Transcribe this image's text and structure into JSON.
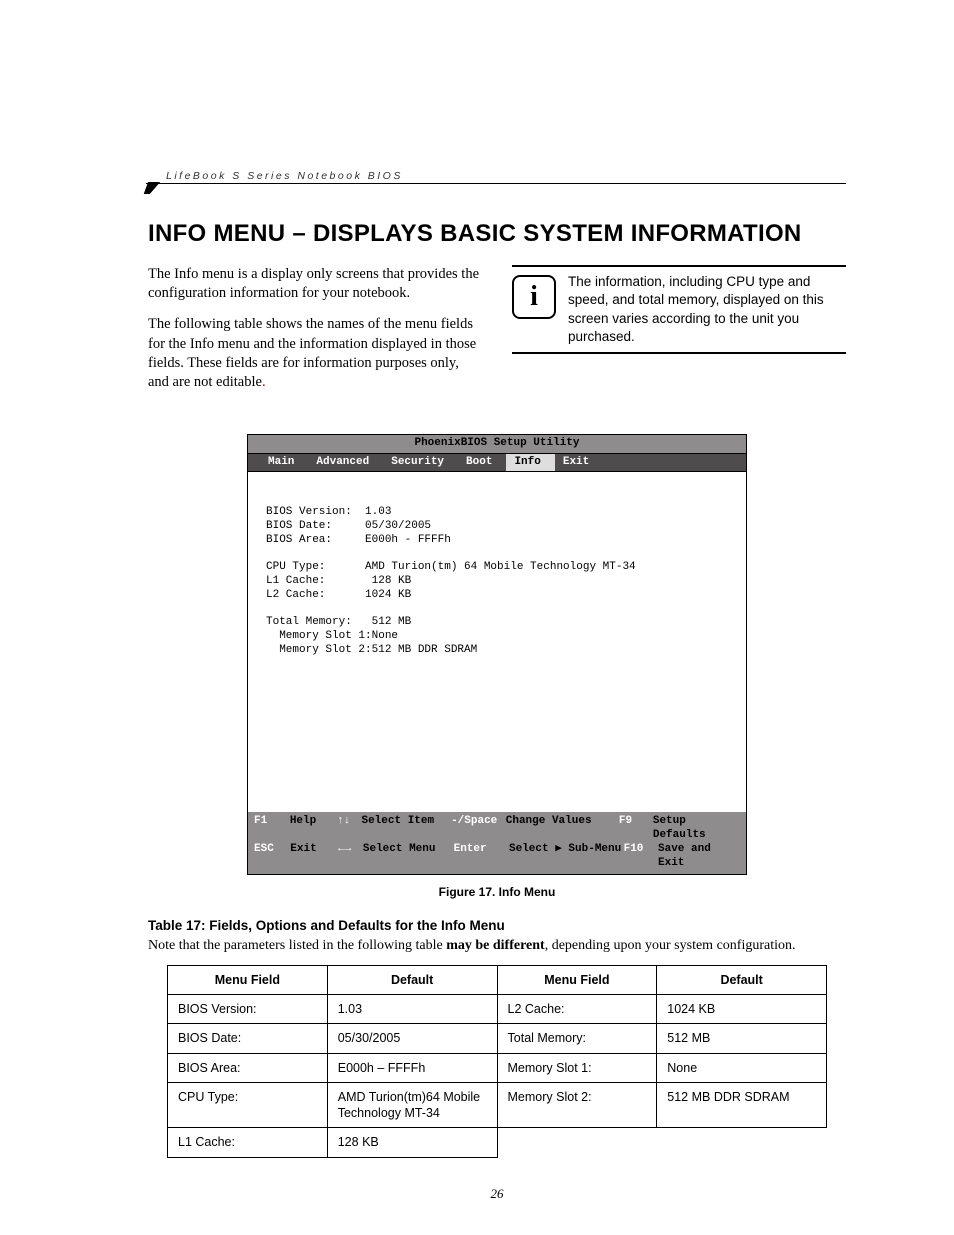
{
  "header": {
    "running": "LifeBook S Series Notebook BIOS"
  },
  "title": "INFO MENU – DISPLAYS BASIC SYSTEM INFORMATION",
  "para1": "The Info menu is a display only screens that provides the configuration information for your notebook.",
  "para2a": "The following table shows the names of the menu fields for the Info menu and the information displayed in those fields. These fields are for information purposes only, and are not editable",
  "para2b": ".",
  "note": "The information, including CPU type and speed, and total memory, displayed on this screen varies according to the unit you purchased.",
  "bios": {
    "title": "PhoenixBIOS Setup Utility",
    "tabs": [
      "Main",
      "Advanced",
      "Security",
      "Boot",
      "Info",
      "Exit"
    ],
    "active_tab": 4,
    "rows": [
      {
        "label": "BIOS Version:",
        "value": "1.03"
      },
      {
        "label": "BIOS Date:",
        "value": "05/30/2005"
      },
      {
        "label": "BIOS Area:",
        "value": "E000h - FFFFh"
      },
      {
        "label": "",
        "value": ""
      },
      {
        "label": "CPU Type:",
        "value": "AMD Turion(tm) 64 Mobile Technology MT-34"
      },
      {
        "label": "L1 Cache:",
        "value": " 128 KB"
      },
      {
        "label": "L2 Cache:",
        "value": "1024 KB"
      },
      {
        "label": "",
        "value": ""
      },
      {
        "label": "Total Memory:",
        "value": " 512 MB"
      },
      {
        "label": "  Memory Slot 1:",
        "value": "None",
        "indent": true
      },
      {
        "label": "  Memory Slot 2:",
        "value": "512 MB DDR SDRAM",
        "indent": true
      }
    ],
    "footer": {
      "r1": {
        "k1": "F1",
        "a1": "Help",
        "k2": "↑↓",
        "a2": "Select Item",
        "k3": "-/Space",
        "a3": "Change Values",
        "k4": "F9",
        "a4": "Setup Defaults"
      },
      "r2": {
        "k1": "ESC",
        "a1": "Exit",
        "k2": "←→",
        "a2": "Select Menu",
        "k3": "Enter",
        "a3": "Select ▶ Sub-Menu",
        "k4": "F10",
        "a4": "Save and Exit"
      }
    }
  },
  "fig_caption": "Figure 17.   Info Menu",
  "table_title": "Table 17: Fields, Options and Defaults for the Info Menu",
  "table_note_a": "Note that the parameters listed in the following table ",
  "table_note_b": "may be different",
  "table_note_c": ", depending upon your system configuration.",
  "table": {
    "headers": [
      "Menu Field",
      "Default",
      "Menu Field",
      "Default"
    ],
    "rows": [
      [
        "BIOS Version:",
        "1.03",
        "L2 Cache:",
        "1024 KB"
      ],
      [
        "BIOS Date:",
        "05/30/2005",
        "Total Memory:",
        "512 MB"
      ],
      [
        "BIOS Area:",
        "E000h – FFFFh",
        "Memory Slot 1:",
        "None"
      ],
      [
        "CPU Type:",
        "AMD Turion(tm)64 Mobile Technology MT-34",
        "Memory Slot 2:",
        "512 MB DDR SDRAM"
      ],
      [
        "L1 Cache:",
        "128 KB",
        "",
        ""
      ]
    ]
  },
  "page_number": "26"
}
